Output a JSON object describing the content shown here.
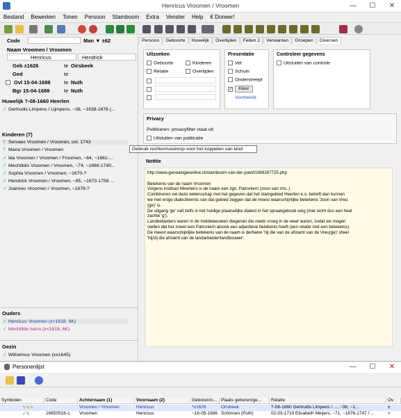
{
  "window": {
    "title": "Henricus Vroomen / Vroomen"
  },
  "menu": [
    "Bestand",
    "Bewerken",
    "Tonen",
    "Persoon",
    "Stamboom",
    "Extra",
    "Venster",
    "Help",
    "€ Doneer!"
  ],
  "person": {
    "code_label": "Code",
    "gender": "Man ▼ ±62",
    "name_header": "Naam Vroomen / Vroomen",
    "firstname": "Henricus",
    "surname": "Hendrick",
    "geb_label": "Geb ±1626",
    "geb_te": "te",
    "geb_place": "Oirsbeek",
    "ged_label": "Ged",
    "ged_te": "te",
    "ovl_label": "Ovl 15-04-1688",
    "ovl_te": "te",
    "ovl_place": "Nuth",
    "bgr_label": "Bgr 15-04-1688",
    "bgr_te": "te",
    "bgr_place": "Nuth"
  },
  "marriage": {
    "header": "Huwelijk ?-08-1660 Heerlen",
    "spouse": "Gertrudis Limpens / Lijmpens, ~38, ~1638-1676 (..."
  },
  "children": {
    "header": "Kinderen (7)",
    "items": [
      {
        "mark": "?",
        "text": "Servaes Vroomen / Vroomen, ovl. 1743"
      },
      {
        "mark": "?",
        "text": "Maria Vroomen / Vroomen"
      },
      {
        "mark": "✓",
        "text": "Ida Vroomen / Vroomen / Froomen, ~64, ~1661-..."
      },
      {
        "mark": "✓",
        "text": "Mechtildis Vroomen / Vroomen, ~74, ~1666-1740..."
      },
      {
        "mark": "✓",
        "text": "Sophia Vroomen / Vroomen, ~1670-?"
      },
      {
        "mark": "✓",
        "text": "Hendrick Vroomen / Vroomen, ~85, ~1673-1758 ..."
      },
      {
        "mark": "✓",
        "text": "Joannes Vroomen / Vroomen, ~1676-?"
      }
    ]
  },
  "parents": {
    "header": "Ouders",
    "items": [
      "Henricus Vroomen (x<1618, 6K)",
      "Mechtilde Ivens (x<1618, 6K)"
    ]
  },
  "family": {
    "header": "Gezin",
    "items": [
      "Wilhelmus Vroomen (x±1645)"
    ]
  },
  "tabs": [
    "Persoon",
    "Geboorte",
    "Huwelijk",
    "Overlijden",
    "Feiten 2",
    "Verwanten",
    "Groepen",
    "Diversen"
  ],
  "uitzoeken": {
    "title": "Uitzoeken",
    "opts": [
      "Geboorte",
      "Kinderen",
      "Relatie",
      "Overlijden"
    ]
  },
  "presentatie": {
    "title": "Presentatie",
    "opts": [
      "Vet",
      "Schuin",
      "Onderstreept"
    ],
    "kleur": "Kleur",
    "voorbeeld": "Voorbeeld"
  },
  "controleer": {
    "title": "Controleer gegevens",
    "opt": "Uitsluiten van controle"
  },
  "privacy": {
    "title": "Privacy",
    "text": "Publiceren: privacyfilter staat uit",
    "opt": "Uitsluiten van publicatie"
  },
  "notitie": {
    "title": "Notitie",
    "url": "http://www.genealogieonline.nl/stamboom-van-der-poel/I1069267725.php",
    "lines": [
      "Betekenis van de naam Vroomen",
      " Volgens instituut Meertens is de naam een zgn. Patroniem (zoon van Vro..)",
      " Combineren we deze wetenschap met het gegeven dat het stamgebied Heerlen e.o. betreft dan kunnen",
      "we met enige dialectkennis van dat gebied zeggen dat de meest waarschijnlijke betekenis 'zoon van Vreu",
      "(ge)' is.",
      " De uitgang 'ge' valt zelfs in het huidige plaatselijke dialect in het spraakgebruik weg (met recht dus een heel",
      "zachte 'g').",
      " Landbebieders waren in de middeleeuwen diegenen die reeds vroeg in de weer waren, zodat we mogen",
      "stellen dat het zowel een Patroniem alsook een adjectieve betekenis heeft (een relatie met een betekenis).",
      " De meest waarschijnlijke betekenis van de naam is derhalve 'hij die van de afstamt van de Vreu(ge)' ofwel",
      "'hij/zij die afstamt van de landarbeider/landbouwer'."
    ]
  },
  "tooltip": "Gebruik rechtermuisknop voor het koppelen van kind",
  "personenlijst": {
    "title": "Personenlijst",
    "columns": [
      "Symbolen",
      "Code",
      "Achternaam (1)",
      "Voornaam (2)",
      "Geboren/o...",
      "Plaats geboren/ge...",
      "Relatie",
      "Ov"
    ],
    "rows": [
      [
        "",
        "",
        "Vroomen / Vroomen",
        "Henricus",
        "*±1626",
        "Oirsbeek",
        "?-08-1660 Gertrudis Limpens / ..., ~38, ~1...",
        "±"
      ],
      [
        "",
        "16650516-1",
        "Vroomen",
        "Henricus",
        "~16-05-1666",
        "Schinnen (Puth)",
        "02-03-1710 Elisabeth Meijers, ~71, ~1676-1747 / ...",
        "+"
      ]
    ]
  }
}
